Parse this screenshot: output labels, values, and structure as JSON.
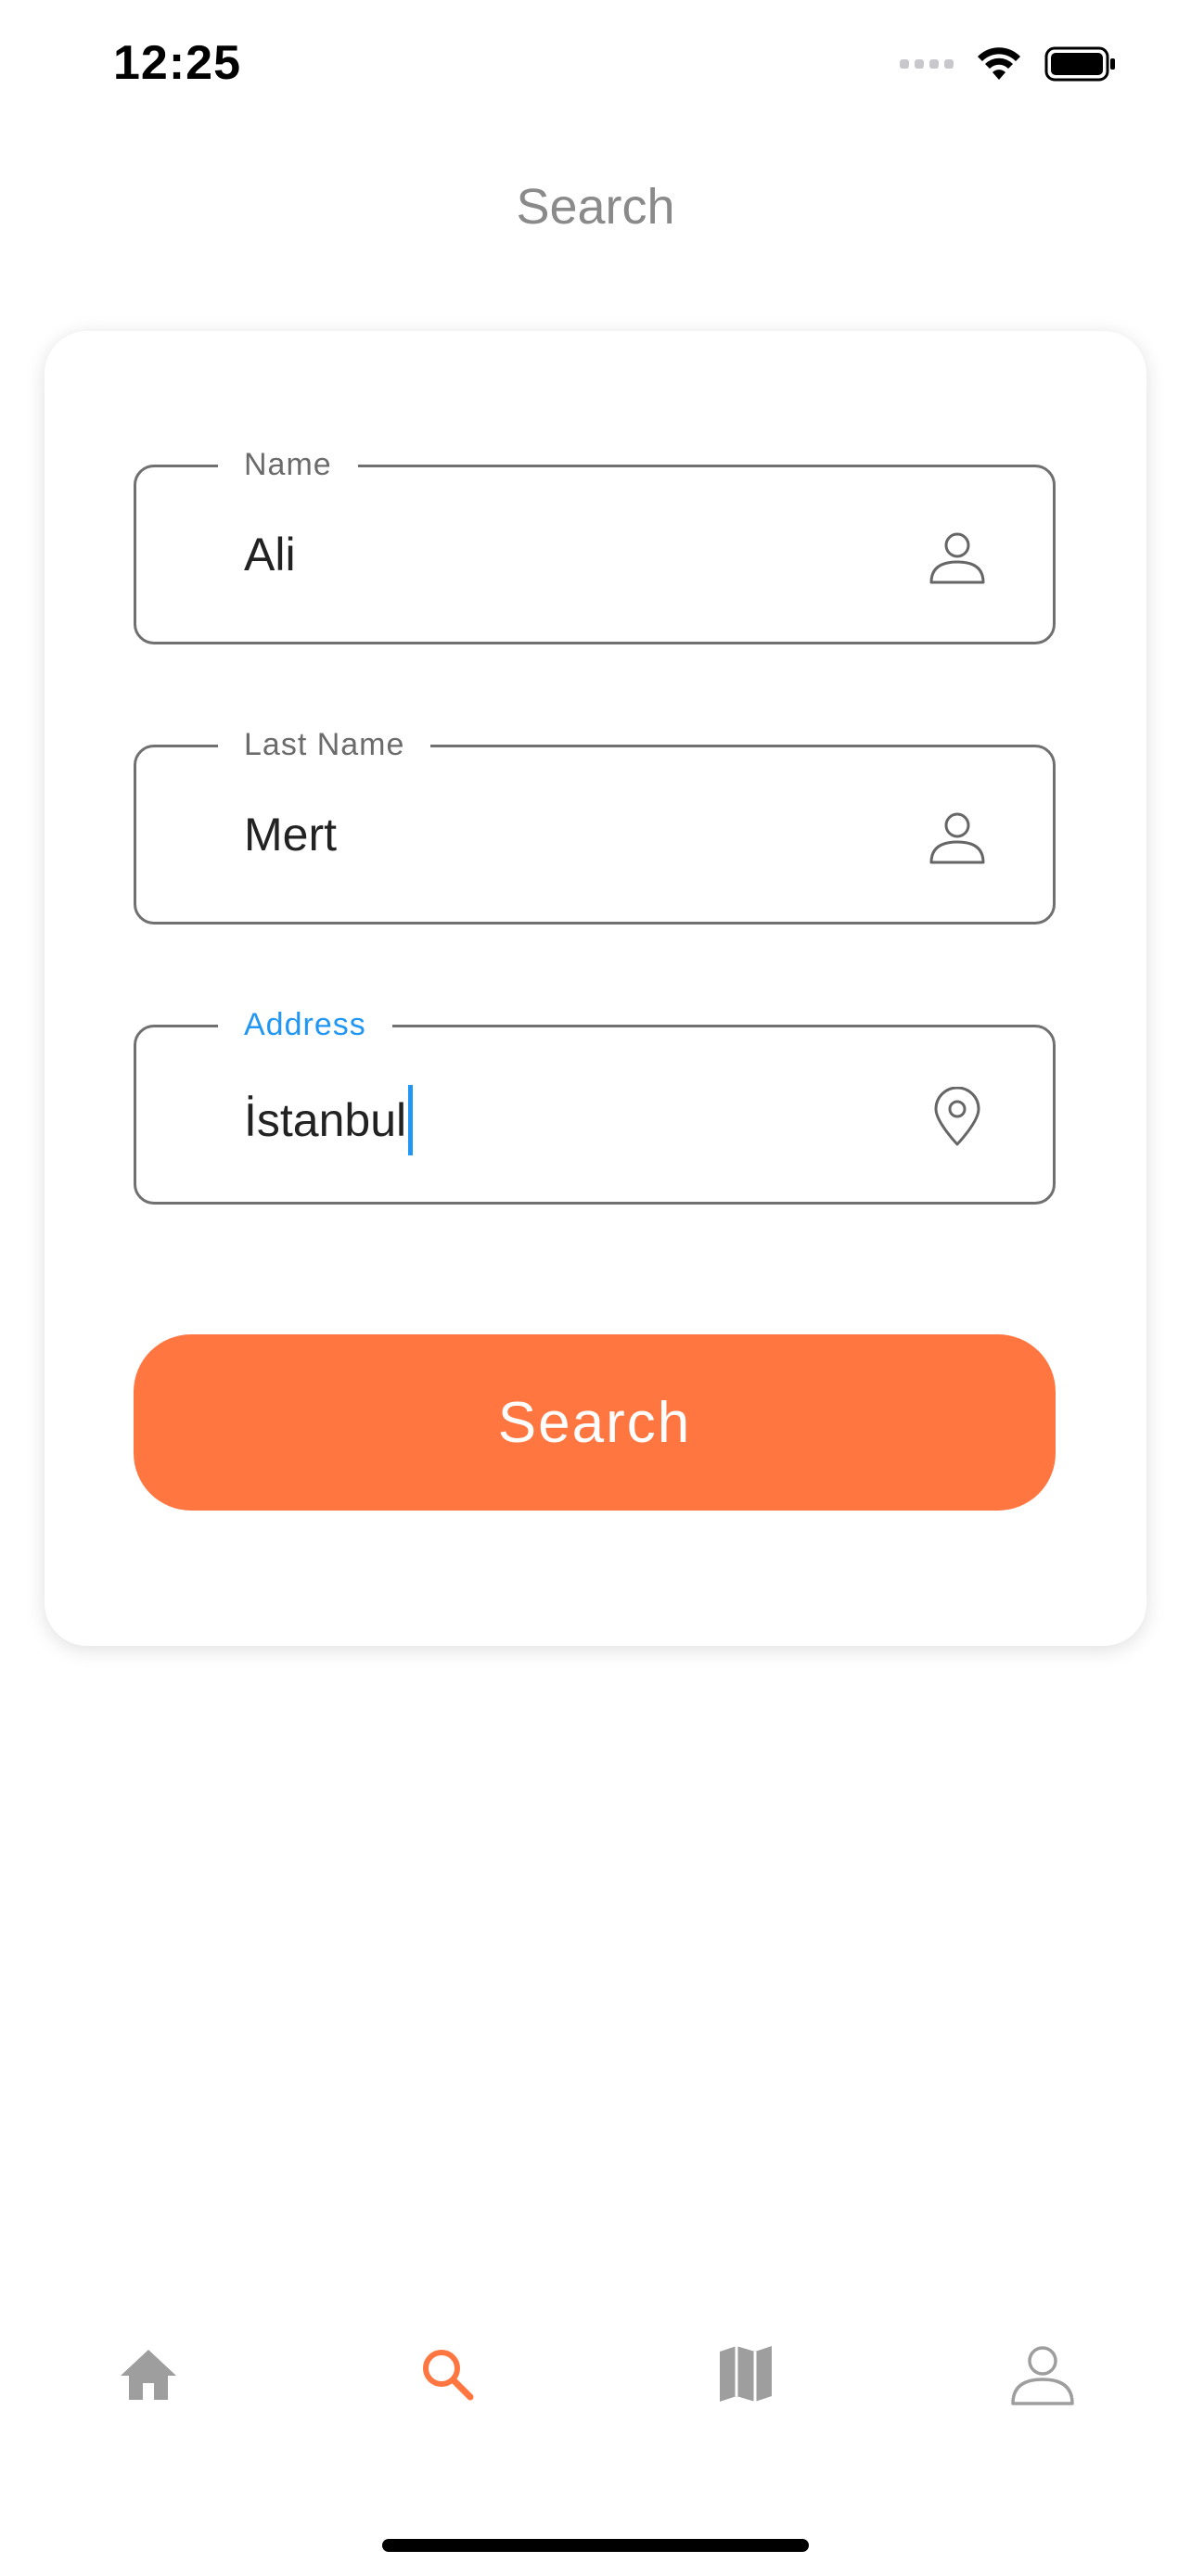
{
  "status_bar": {
    "time": "12:25"
  },
  "header": {
    "title": "Search"
  },
  "form": {
    "name": {
      "label": "Name",
      "value": "Ali",
      "icon": "person-icon"
    },
    "last_name": {
      "label": "Last Name",
      "value": "Mert",
      "icon": "person-icon"
    },
    "address": {
      "label": "Address",
      "value": "İstanbul",
      "icon": "location-pin-icon",
      "focused": true
    },
    "search_button_label": "Search"
  },
  "tabbar": {
    "items": [
      {
        "name": "home",
        "icon": "home-icon",
        "active": false
      },
      {
        "name": "search",
        "icon": "search-icon",
        "active": true
      },
      {
        "name": "map",
        "icon": "map-icon",
        "active": false
      },
      {
        "name": "profile",
        "icon": "person-icon",
        "active": false
      }
    ]
  },
  "colors": {
    "accent": "#ff7641",
    "focus": "#2196f3",
    "inactive_tab": "#9e9e9e",
    "title_gray": "#8a8a8a"
  }
}
